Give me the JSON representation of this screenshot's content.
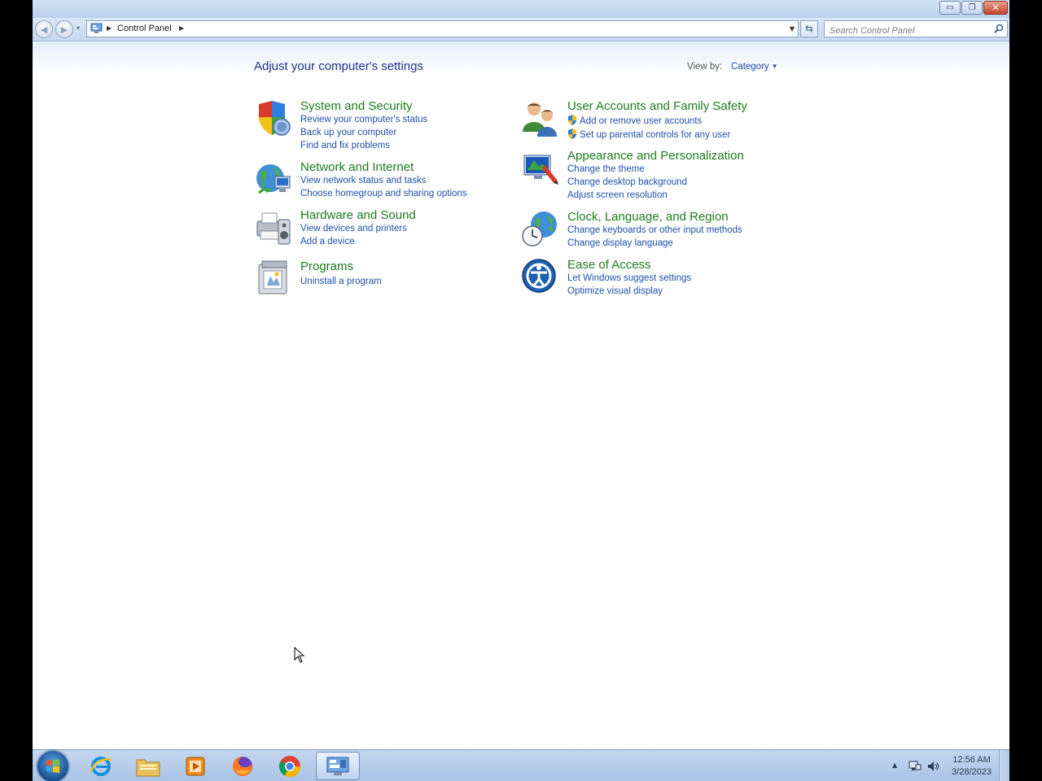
{
  "window": {
    "minimize": "▭",
    "maximize": "❐",
    "close": "✕"
  },
  "nav": {
    "back_icon": "back-arrow-icon",
    "forward_icon": "forward-arrow-icon",
    "breadcrumb": [
      "Control Panel"
    ],
    "search_placeholder": "Search Control Panel"
  },
  "header": {
    "title": "Adjust your computer's settings",
    "view_by_label": "View by:",
    "view_by_value": "Category"
  },
  "categories": [
    {
      "title": "System and Security",
      "icon": "shield-icon",
      "links": [
        {
          "text": "Review your computer's status",
          "shield": false
        },
        {
          "text": "Back up your computer",
          "shield": false
        },
        {
          "text": "Find and fix problems",
          "shield": false
        }
      ]
    },
    {
      "title": "Network and Internet",
      "icon": "globe-network-icon",
      "links": [
        {
          "text": "View network status and tasks",
          "shield": false
        },
        {
          "text": "Choose homegroup and sharing options",
          "shield": false
        }
      ]
    },
    {
      "title": "Hardware and Sound",
      "icon": "printer-speaker-icon",
      "links": [
        {
          "text": "View devices and printers",
          "shield": false
        },
        {
          "text": "Add a device",
          "shield": false
        }
      ]
    },
    {
      "title": "Programs",
      "icon": "programs-icon",
      "links": [
        {
          "text": "Uninstall a program",
          "shield": false
        }
      ]
    },
    {
      "title": "User Accounts and Family Safety",
      "icon": "users-icon",
      "links": [
        {
          "text": "Add or remove user accounts",
          "shield": true
        },
        {
          "text": "Set up parental controls for any user",
          "shield": true
        }
      ]
    },
    {
      "title": "Appearance and Personalization",
      "icon": "display-paint-icon",
      "links": [
        {
          "text": "Change the theme",
          "shield": false
        },
        {
          "text": "Change desktop background",
          "shield": false
        },
        {
          "text": "Adjust screen resolution",
          "shield": false
        }
      ]
    },
    {
      "title": "Clock, Language, and Region",
      "icon": "clock-globe-icon",
      "links": [
        {
          "text": "Change keyboards or other input methods",
          "shield": false
        },
        {
          "text": "Change display language",
          "shield": false
        }
      ]
    },
    {
      "title": "Ease of Access",
      "icon": "ease-of-access-icon",
      "links": [
        {
          "text": "Let Windows suggest settings",
          "shield": false
        },
        {
          "text": "Optimize visual display",
          "shield": false
        }
      ]
    }
  ],
  "taskbar": {
    "items": [
      "internet-explorer-icon",
      "file-explorer-icon",
      "media-player-icon",
      "firefox-icon",
      "chrome-icon",
      "control-panel-icon"
    ],
    "time": "12:56 AM",
    "date": "3/28/2023"
  },
  "colors": {
    "category_title": "#1e7b1e",
    "link": "#1e50a8",
    "heading": "#1e3287"
  }
}
